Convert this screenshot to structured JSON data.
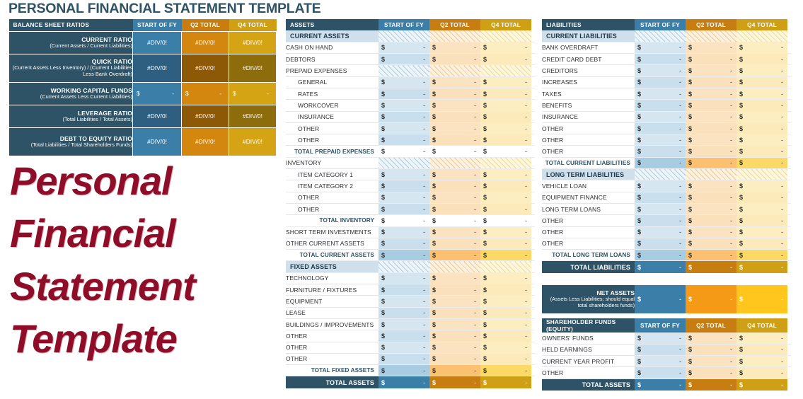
{
  "page_title": "PERSONAL FINANCIAL STATEMENT TEMPLATE",
  "overlay": {
    "line1": "Personal",
    "line2": "Financial",
    "line3": "Statement",
    "line4": "Template"
  },
  "colors": {
    "navy": "#2e5266",
    "blue": "#3b7ea8",
    "orange": "#c87d10",
    "gold": "#cfa015",
    "bright_orange": "#f59a16",
    "bright_yellow": "#ffc61e",
    "overlay_red": "#8e0d28",
    "section_band": "#cfe0ec"
  },
  "columns": {
    "fy": "START OF FY",
    "q2": "Q2 TOTAL",
    "q4": "Q4 TOTAL"
  },
  "money": {
    "symbol": "$",
    "value": "-"
  },
  "div_error": "#DIV/0!",
  "ratios": {
    "header": "BALANCE SHEET RATIOS",
    "rows": [
      {
        "title": "CURRENT RATIO",
        "sub": "(Current Assets / Current Liabilities)",
        "fy": "#DIV/0!",
        "q2": "#DIV/0!",
        "q4": "#DIV/0!",
        "kind": "err"
      },
      {
        "title": "QUICK RATIO",
        "sub": "(Current Assets Less Inventory) / (Current Liabilities Less Bank Overdraft)",
        "fy": "#DIV/0!",
        "q2": "#DIV/0!",
        "q4": "#DIV/0!",
        "kind": "err"
      },
      {
        "title": "WORKING CAPITAL FUNDS",
        "sub": "(Current Assets Less Current Liabilities)",
        "fy": "-",
        "q2": "-",
        "q4": "-",
        "kind": "money"
      },
      {
        "title": "LEVERAGE RATIO",
        "sub": "(Total Liabilities / Total Assets)",
        "fy": "#DIV/0!",
        "q2": "#DIV/0!",
        "q4": "#DIV/0!",
        "kind": "err"
      },
      {
        "title": "DEBT TO EQUITY RATIO",
        "sub": "(Total Liabilities / Total Shareholders Funds)",
        "fy": "#DIV/0!",
        "q2": "#DIV/0!",
        "q4": "#DIV/0!",
        "kind": "err"
      }
    ]
  },
  "assets": {
    "header": "ASSETS",
    "rows": [
      {
        "label": "CURRENT ASSETS",
        "type": "section"
      },
      {
        "label": "CASH ON HAND",
        "type": "item"
      },
      {
        "label": "DEBTORS",
        "type": "item"
      },
      {
        "label": "PREPAID EXPENSES",
        "type": "section-plain"
      },
      {
        "label": "GENERAL",
        "type": "sub"
      },
      {
        "label": "RATES",
        "type": "sub"
      },
      {
        "label": "WORKCOVER",
        "type": "sub"
      },
      {
        "label": "INSURANCE",
        "type": "sub"
      },
      {
        "label": "OTHER",
        "type": "sub"
      },
      {
        "label": "OTHER",
        "type": "sub"
      },
      {
        "label": "TOTAL PREPAID EXPENSES",
        "type": "subtotal"
      },
      {
        "label": "INVENTORY",
        "type": "section-plain"
      },
      {
        "label": "ITEM CATEGORY 1",
        "type": "sub"
      },
      {
        "label": "ITEM CATEGORY 2",
        "type": "sub"
      },
      {
        "label": "OTHER",
        "type": "sub"
      },
      {
        "label": "OTHER",
        "type": "sub"
      },
      {
        "label": "TOTAL INVENTORY",
        "type": "subtotal"
      },
      {
        "label": "SHORT TERM INVESTMENTS",
        "type": "item"
      },
      {
        "label": "OTHER CURRENT ASSETS",
        "type": "item"
      },
      {
        "label": "TOTAL CURRENT ASSETS",
        "type": "total"
      },
      {
        "label": "FIXED ASSETS",
        "type": "section"
      },
      {
        "label": "TECHNOLOGY",
        "type": "item"
      },
      {
        "label": "FURNITURE / FIXTURES",
        "type": "item"
      },
      {
        "label": "EQUIPMENT",
        "type": "item"
      },
      {
        "label": "LEASE",
        "type": "item"
      },
      {
        "label": "BUILDINGS / IMPROVEMENTS",
        "type": "item"
      },
      {
        "label": "OTHER",
        "type": "item"
      },
      {
        "label": "OTHER",
        "type": "item"
      },
      {
        "label": "OTHER",
        "type": "item"
      },
      {
        "label": "TOTAL FIXED ASSETS",
        "type": "total"
      },
      {
        "label": "TOTAL ASSETS",
        "type": "grand"
      }
    ]
  },
  "liabilities": {
    "header": "LIABILITIES",
    "rows": [
      {
        "label": "CURRENT LIABILITIES",
        "type": "section"
      },
      {
        "label": "BANK OVERDRAFT",
        "type": "item"
      },
      {
        "label": "CREDIT CARD DEBT",
        "type": "item"
      },
      {
        "label": "CREDITORS",
        "type": "item"
      },
      {
        "label": "INCREASES",
        "type": "item"
      },
      {
        "label": "TAXES",
        "type": "item"
      },
      {
        "label": "BENEFITS",
        "type": "item"
      },
      {
        "label": "INSURANCE",
        "type": "item"
      },
      {
        "label": "OTHER",
        "type": "item"
      },
      {
        "label": "OTHER",
        "type": "item"
      },
      {
        "label": "OTHER",
        "type": "item"
      },
      {
        "label": "TOTAL CURRENT LIABILITIES",
        "type": "total"
      },
      {
        "label": "LONG TERM LIABILITIES",
        "type": "section"
      },
      {
        "label": "VEHICLE LOAN",
        "type": "item"
      },
      {
        "label": "EQUIPMENT FINANCE",
        "type": "item"
      },
      {
        "label": "LONG TERM LOANS",
        "type": "item"
      },
      {
        "label": "OTHER",
        "type": "item"
      },
      {
        "label": "OTHER",
        "type": "item"
      },
      {
        "label": "OTHER",
        "type": "item"
      },
      {
        "label": "TOTAL LONG TERM LOANS",
        "type": "total"
      },
      {
        "label": "TOTAL LIABILITIES",
        "type": "grand"
      }
    ]
  },
  "net_assets": {
    "title": "NET ASSETS",
    "sub": "(Assets Less Liabilities; should equal total shareholders funds)",
    "fy": "-",
    "q2": "-",
    "q4": "-"
  },
  "equity": {
    "header": "SHAREHOLDER FUNDS (EQUITY)",
    "rows": [
      {
        "label": "OWNERS' FUNDS",
        "type": "item"
      },
      {
        "label": "HELD EARNINGS",
        "type": "item"
      },
      {
        "label": "CURRENT YEAR PROFIT",
        "type": "item"
      },
      {
        "label": "OTHER",
        "type": "item"
      },
      {
        "label": "TOTAL ASSETS",
        "type": "grand"
      }
    ]
  }
}
